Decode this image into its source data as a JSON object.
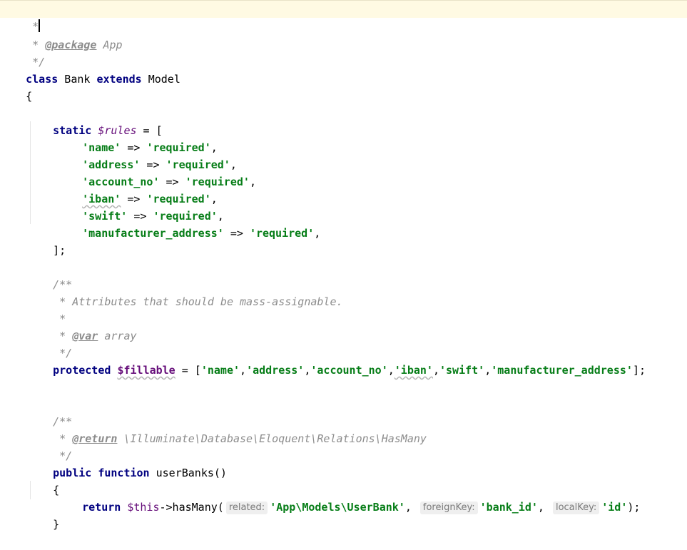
{
  "code": {
    "l1_comment": " *",
    "l2_comment_star": " * ",
    "l2_tag": "@package",
    "l2_value": " App",
    "l3_comment": " */",
    "l4_kw_class": "class",
    "l4_name": " Bank ",
    "l4_kw_extends": "extends",
    "l4_parent": " Model",
    "l5_brace": "{",
    "l7_kw_static": "static",
    "l7_var": "$rules",
    "l7_rest": " = [",
    "rules": [
      {
        "key": "'name'",
        "value": "'required'"
      },
      {
        "key": "'address'",
        "value": "'required'"
      },
      {
        "key": "'account_no'",
        "value": "'required'"
      },
      {
        "key": "'iban'",
        "value": "'required'"
      },
      {
        "key": "'swift'",
        "value": "'required'"
      },
      {
        "key": "'manufacturer_address'",
        "value": "'required'"
      }
    ],
    "arrow": " => ",
    "comma": ",",
    "l14_close": "];",
    "l16_doc_open": "/**",
    "l17_doc": " * Attributes that should be mass-assignable.",
    "l18_doc": " *",
    "l19_star": " * ",
    "l19_tag": "@var",
    "l19_value": " array",
    "l20_doc_close": " */",
    "l21_kw": "protected",
    "l21_field": "$fillable",
    "l21_eq": " = [",
    "fillable": [
      "'name'",
      "'address'",
      "'account_no'",
      "'iban'",
      "'swift'",
      "'manufacturer_address'"
    ],
    "l21_close": "];",
    "l24_doc_open": "/**",
    "l25_star": " * ",
    "l25_tag": "@return",
    "l25_value": " \\Illuminate\\Database\\Eloquent\\Relations\\HasMany",
    "l26_doc_close": " */",
    "l27_kw_public": "public",
    "l27_kw_function": "function",
    "l27_name": " userBanks()",
    "l28_brace": "{",
    "l29_kw_return": "return",
    "l29_this": "$this",
    "l29_call": "->hasMany(",
    "l29_hint_related": "related:",
    "l29_arg_related": "'App\\Models\\UserBank'",
    "l29_hint_foreign": "foreignKey:",
    "l29_arg_foreign": "'bank_id'",
    "l29_hint_local": "localKey:",
    "l29_arg_local": "'id'",
    "l29_end": ");",
    "l30_brace": "}"
  }
}
